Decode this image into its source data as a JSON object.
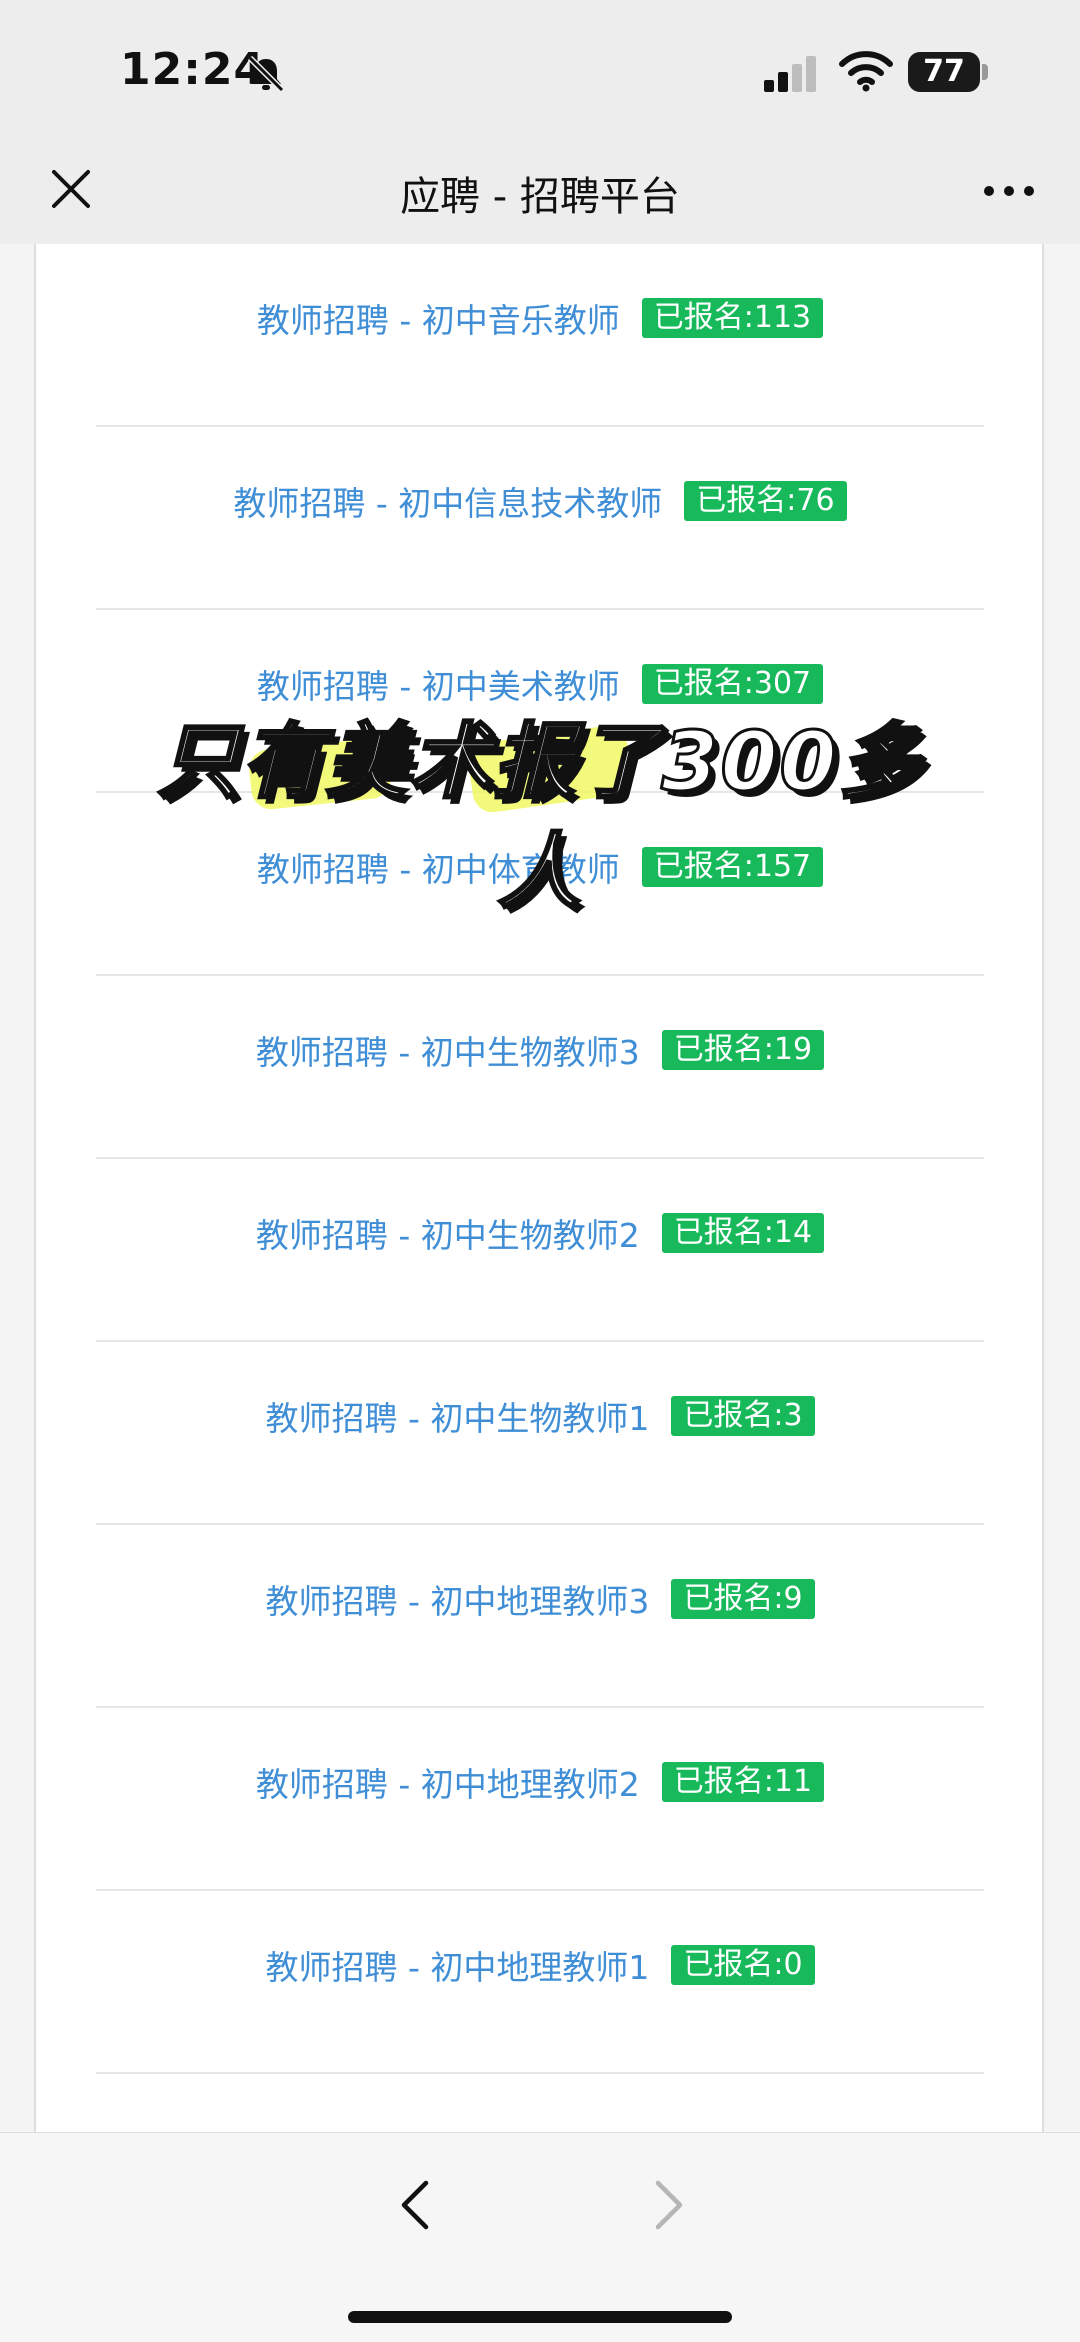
{
  "status_bar": {
    "time": "12:24",
    "battery": "77",
    "icons": [
      "bell-off-icon",
      "signal-icon",
      "wifi-icon",
      "battery-icon"
    ]
  },
  "nav": {
    "title": "应聘 - 招聘平台",
    "close_icon": "close-icon",
    "more_icon": "more-icon"
  },
  "jobs": [
    {
      "title": "教师招聘 - 初中音乐教师",
      "badge": "已报名:113"
    },
    {
      "title": "教师招聘 - 初中信息技术教师",
      "badge": "已报名:76"
    },
    {
      "title": "教师招聘 - 初中美术教师",
      "badge": "已报名:307"
    },
    {
      "title": "教师招聘 - 初中体育教师",
      "badge": "已报名:157"
    },
    {
      "title": "教师招聘 - 初中生物教师3",
      "badge": "已报名:19"
    },
    {
      "title": "教师招聘 - 初中生物教师2",
      "badge": "已报名:14"
    },
    {
      "title": "教师招聘 - 初中生物教师1",
      "badge": "已报名:3"
    },
    {
      "title": "教师招聘 - 初中地理教师3",
      "badge": "已报名:9"
    },
    {
      "title": "教师招聘 - 初中地理教师2",
      "badge": "已报名:11"
    },
    {
      "title": "教师招聘 - 初中地理教师1",
      "badge": "已报名:0"
    }
  ],
  "overlay": {
    "caption": "只有美术报了300多人",
    "highlight_color": "#f0f85a"
  },
  "colors": {
    "link": "#3f8ed6",
    "badge": "#17b95a"
  },
  "bottom_bar": {
    "back_icon": "chevron-left-icon",
    "forward_icon": "chevron-right-icon"
  }
}
